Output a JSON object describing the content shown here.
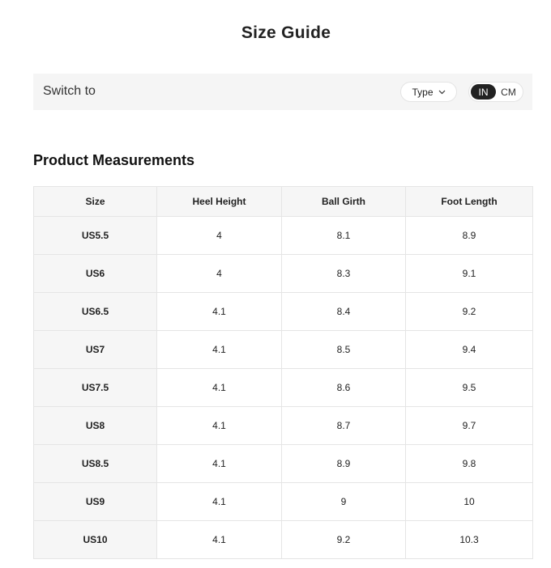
{
  "header": {
    "title": "Size Guide"
  },
  "switch_bar": {
    "label": "Switch to",
    "type_dropdown": {
      "label": "Type",
      "icon": "chevron-down-icon"
    },
    "unit_toggle": {
      "options": [
        "IN",
        "CM"
      ],
      "selected": "IN"
    }
  },
  "measurements": {
    "section_title": "Product Measurements",
    "columns": [
      "Size",
      "Heel Height",
      "Ball Girth",
      "Foot Length"
    ],
    "rows": [
      [
        "US5.5",
        "4",
        "8.1",
        "8.9"
      ],
      [
        "US6",
        "4",
        "8.3",
        "9.1"
      ],
      [
        "US6.5",
        "4.1",
        "8.4",
        "9.2"
      ],
      [
        "US7",
        "4.1",
        "8.5",
        "9.4"
      ],
      [
        "US7.5",
        "4.1",
        "8.6",
        "9.5"
      ],
      [
        "US8",
        "4.1",
        "8.7",
        "9.7"
      ],
      [
        "US8.5",
        "4.1",
        "8.9",
        "9.8"
      ],
      [
        "US9",
        "4.1",
        "9",
        "10"
      ],
      [
        "US10",
        "4.1",
        "9.2",
        "10.3"
      ]
    ]
  },
  "colors": {
    "panel_background": "#f5f5f5",
    "active_toggle": "#222222",
    "table_border": "#e5e5e5",
    "header_cell_background": "#f6f6f6"
  }
}
